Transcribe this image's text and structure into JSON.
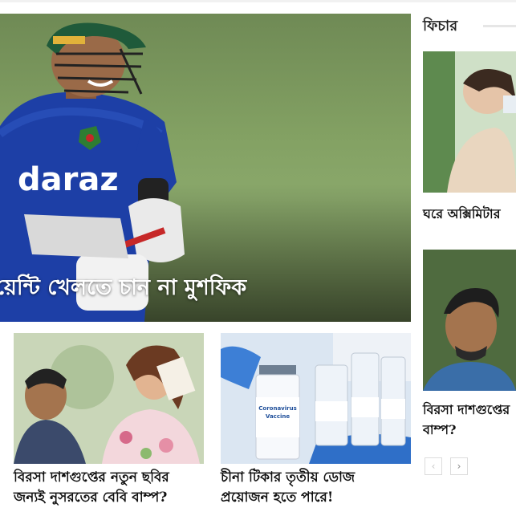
{
  "hero": {
    "title": "য়েন্টি খেলতে চান না মুশফিক",
    "jersey_text": "daraz"
  },
  "cards": [
    {
      "title_line1": "বিরসা দাশগুপ্তের নতুন ছবির",
      "title_line2": "জন্যই নুসরতের বেবি বাম্প?"
    },
    {
      "title_line1": "চীনা টিকার তৃতীয় ডোজ",
      "title_line2": "প্রয়োজন হতে পারে!"
    }
  ],
  "sidebar": {
    "section_title": "ফিচার",
    "items": [
      {
        "title_line1": "ঘরে অক্সিমিটার"
      },
      {
        "title_line1": "বিরসা দাশগুপ্তের",
        "title_line2": "বাম্প?"
      }
    ],
    "prev_label": "‹",
    "next_label": "›"
  },
  "vaccine": {
    "label1": "Coronavirus",
    "label2": "Vaccine"
  },
  "colors": {
    "jersey": "#1d3fa6",
    "field": "#83a163",
    "accent_red": "#c62828"
  }
}
